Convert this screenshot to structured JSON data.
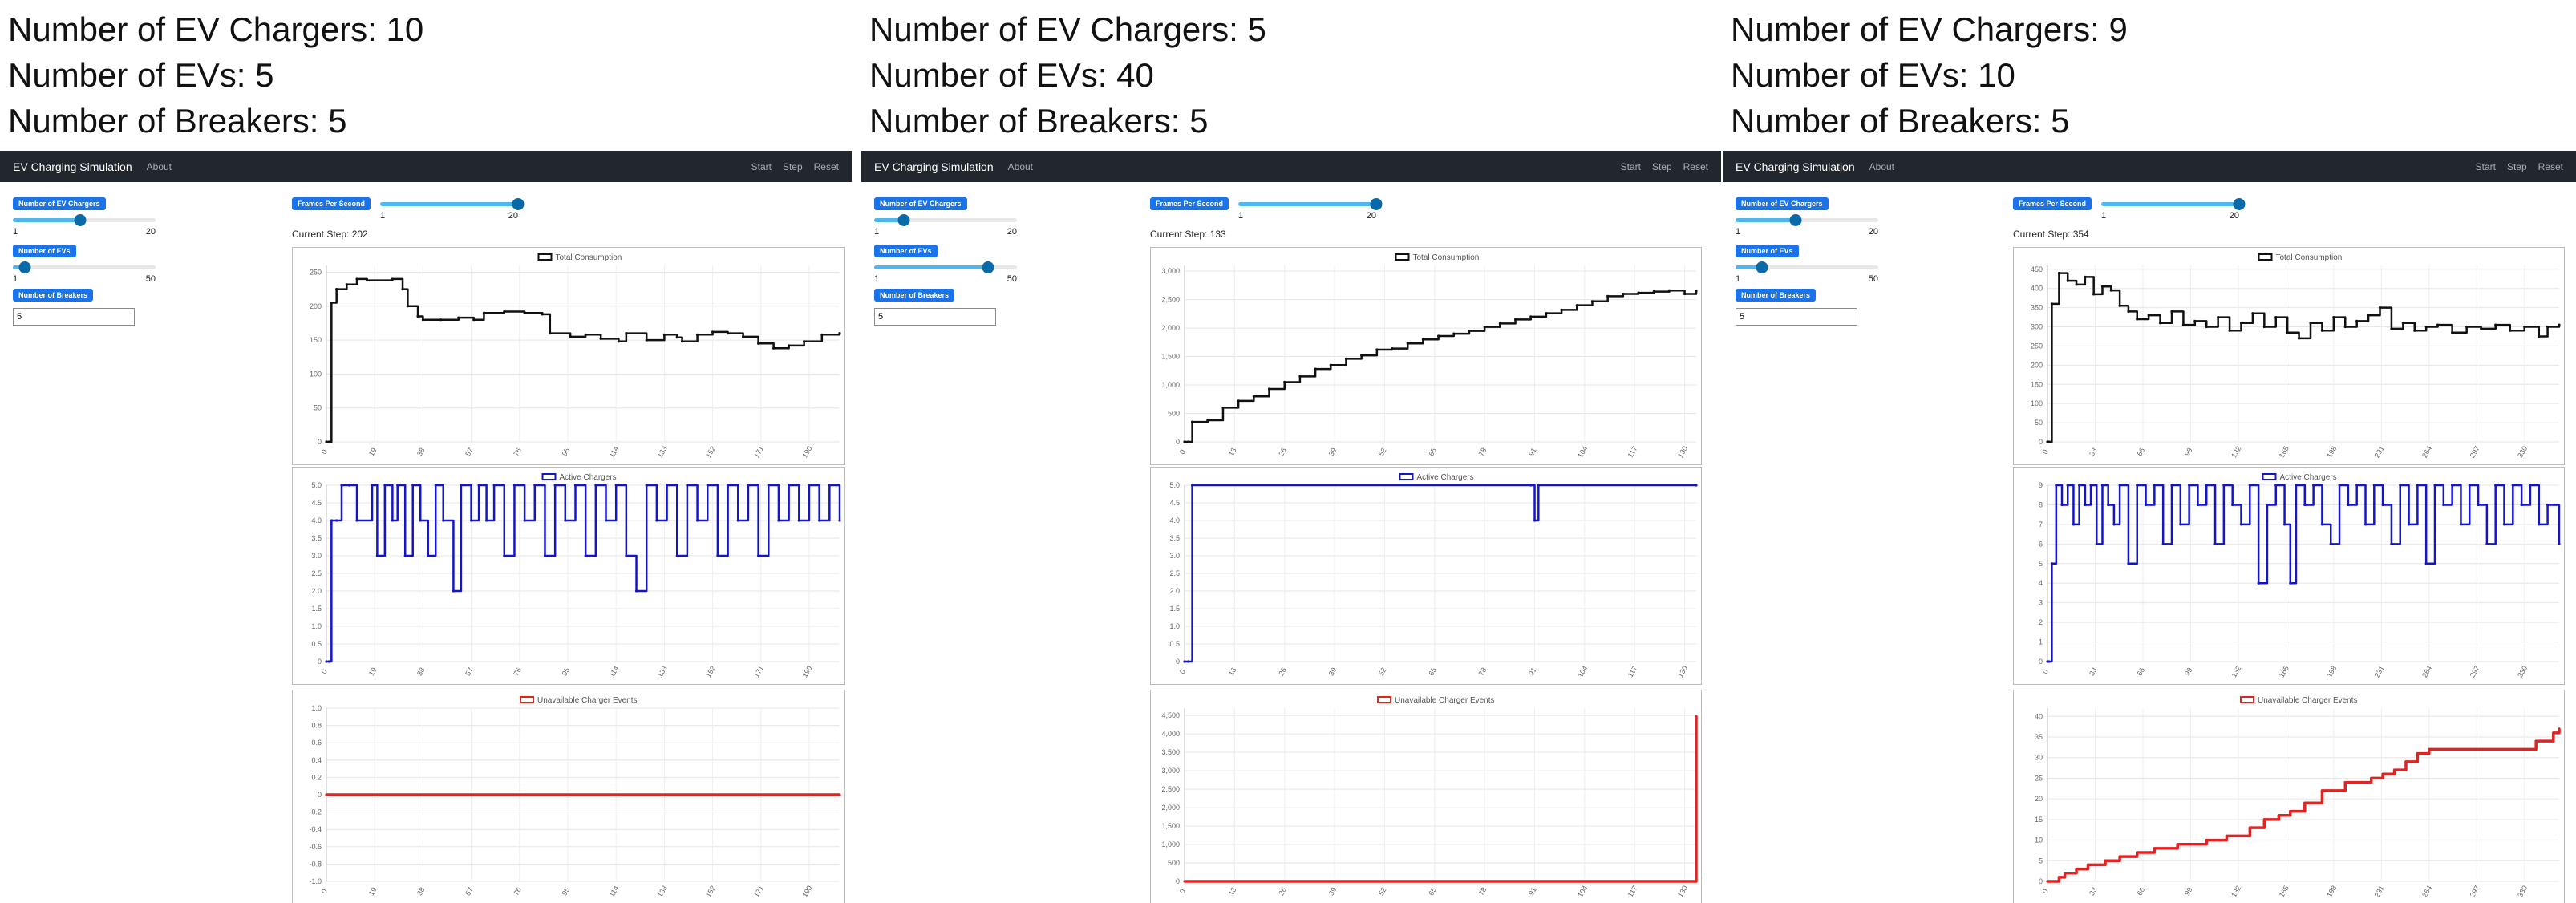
{
  "captions": [
    {
      "chargers": "Number of EV Chargers: 10",
      "evs": "Number of EVs: 5",
      "breakers": "Number of Breakers: 5"
    },
    {
      "chargers": "Number of EV Chargers: 5",
      "evs": "Number of EVs: 40",
      "breakers": "Number of Breakers: 5"
    },
    {
      "chargers": "Number of EV Chargers: 9",
      "evs": "Number of EVs: 10",
      "breakers": "Number of Breakers: 5"
    }
  ],
  "navbar": {
    "brand": "EV Charging Simulation",
    "about": "About",
    "start": "Start",
    "step": "Step",
    "reset": "Reset"
  },
  "controls": {
    "chargers_label": "Number of EV Chargers",
    "evs_label": "Number of EVs",
    "breakers_label": "Number of Breakers",
    "fps_label": "Frames Per Second",
    "current_step_prefix": "Current Step: "
  },
  "panels": [
    {
      "chargers": {
        "value": 10,
        "min": "1",
        "max": "20"
      },
      "evs": {
        "value": 5,
        "min": "1",
        "max": "50"
      },
      "breakers_value": "5",
      "fps": {
        "value": 20,
        "min": "1",
        "max": "20"
      },
      "current_step": "Current Step: 202"
    },
    {
      "chargers": {
        "value": 5,
        "min": "1",
        "max": "20"
      },
      "evs": {
        "value": 40,
        "min": "1",
        "max": "50"
      },
      "breakers_value": "5",
      "fps": {
        "value": 20,
        "min": "1",
        "max": "20"
      },
      "current_step": "Current Step: 133"
    },
    {
      "chargers": {
        "value": 9,
        "min": "1",
        "max": "20"
      },
      "evs": {
        "value": 10,
        "min": "1",
        "max": "50"
      },
      "breakers_value": "5",
      "fps": {
        "value": 20,
        "min": "1",
        "max": "20"
      },
      "current_step": "Current Step: 354"
    }
  ],
  "colors": {
    "consumption": "#111111",
    "active": "#1515c8",
    "unavailable": "#e02424",
    "navbar": "#22272d",
    "badge": "#1a73e8"
  },
  "chart_data": [
    {
      "panel": 1,
      "type": "line",
      "legend": "Total Consumption",
      "x_ticks": [
        "0",
        "19",
        "38",
        "57",
        "76",
        "95",
        "114",
        "133",
        "152",
        "171",
        "190"
      ],
      "y_ticks": [
        "0",
        "50",
        "100",
        "150",
        "200",
        "250"
      ],
      "ylim": [
        0,
        260
      ],
      "xlim": [
        0,
        202
      ],
      "x": [
        0,
        1,
        2,
        4,
        8,
        12,
        16,
        26,
        30,
        32,
        36,
        38,
        45,
        52,
        58,
        62,
        70,
        78,
        85,
        88,
        96,
        102,
        108,
        115,
        118,
        126,
        133,
        138,
        140,
        146,
        152,
        158,
        164,
        170,
        176,
        182,
        188,
        195,
        202
      ],
      "y": [
        0,
        0,
        205,
        225,
        232,
        240,
        238,
        240,
        225,
        200,
        185,
        180,
        180,
        183,
        180,
        190,
        192,
        190,
        188,
        160,
        155,
        158,
        152,
        148,
        160,
        150,
        158,
        154,
        148,
        158,
        162,
        160,
        155,
        145,
        138,
        142,
        148,
        158,
        160
      ]
    },
    {
      "panel": 1,
      "type": "line",
      "legend": "Active Chargers",
      "x_ticks": [
        "0",
        "19",
        "38",
        "57",
        "76",
        "95",
        "114",
        "133",
        "152",
        "171",
        "190"
      ],
      "y_ticks": [
        "0",
        "0.5",
        "1.0",
        "1.5",
        "2.0",
        "2.5",
        "3.0",
        "3.5",
        "4.0",
        "4.5",
        "5.0"
      ],
      "ylim": [
        0,
        5
      ],
      "xlim": [
        0,
        202
      ],
      "x": [
        0,
        1,
        2,
        4,
        6,
        9,
        12,
        18,
        20,
        23,
        26,
        28,
        31,
        34,
        37,
        40,
        43,
        46,
        50,
        53,
        57,
        60,
        63,
        66,
        70,
        74,
        78,
        82,
        86,
        90,
        94,
        98,
        102,
        106,
        110,
        114,
        118,
        122,
        126,
        130,
        134,
        138,
        142,
        146,
        150,
        154,
        158,
        162,
        166,
        170,
        174,
        178,
        182,
        186,
        190,
        194,
        198,
        202
      ],
      "y": [
        0,
        0,
        4,
        4,
        5,
        5,
        4,
        5,
        3,
        5,
        4,
        5,
        3,
        5,
        4,
        3,
        5,
        4,
        2,
        5,
        4,
        5,
        4,
        5,
        3,
        5,
        4,
        5,
        3,
        5,
        4,
        5,
        3,
        5,
        4,
        5,
        3,
        2,
        5,
        4,
        5,
        3,
        5,
        4,
        5,
        3,
        5,
        4,
        5,
        3,
        5,
        4,
        5,
        4,
        5,
        4,
        5,
        4
      ]
    },
    {
      "panel": 1,
      "type": "line",
      "legend": "Unavailable Charger Events",
      "x_ticks": [
        "0",
        "19",
        "38",
        "57",
        "76",
        "95",
        "114",
        "133",
        "152",
        "171",
        "190"
      ],
      "y_ticks": [
        "-1.0",
        "-0.8",
        "-0.6",
        "-0.4",
        "-0.2",
        "0",
        "0.2",
        "0.4",
        "0.6",
        "0.8",
        "1.0"
      ],
      "ylim": [
        -1,
        1
      ],
      "xlim": [
        0,
        202
      ],
      "x": [
        0,
        202
      ],
      "y": [
        0,
        0
      ]
    },
    {
      "panel": 2,
      "type": "line",
      "legend": "Total Consumption",
      "x_ticks": [
        "0",
        "13",
        "26",
        "39",
        "52",
        "65",
        "78",
        "91",
        "104",
        "117",
        "130"
      ],
      "y_ticks": [
        "0",
        "500",
        "1,000",
        "1,500",
        "2,000",
        "2,500",
        "3,000"
      ],
      "ylim": [
        0,
        3100
      ],
      "xlim": [
        0,
        133
      ],
      "x": [
        0,
        1,
        2,
        6,
        10,
        14,
        18,
        22,
        26,
        30,
        34,
        38,
        42,
        46,
        50,
        54,
        58,
        62,
        66,
        70,
        74,
        78,
        82,
        86,
        90,
        94,
        98,
        102,
        106,
        110,
        114,
        118,
        122,
        126,
        130,
        133
      ],
      "y": [
        0,
        0,
        350,
        380,
        600,
        720,
        800,
        930,
        1050,
        1150,
        1280,
        1350,
        1460,
        1520,
        1620,
        1640,
        1730,
        1800,
        1860,
        1900,
        1950,
        2020,
        2080,
        2150,
        2200,
        2260,
        2320,
        2400,
        2470,
        2560,
        2600,
        2620,
        2640,
        2660,
        2600,
        2650
      ]
    },
    {
      "panel": 2,
      "type": "line",
      "legend": "Active Chargers",
      "x_ticks": [
        "0",
        "13",
        "26",
        "39",
        "52",
        "65",
        "78",
        "91",
        "104",
        "117",
        "130"
      ],
      "y_ticks": [
        "0",
        "0.5",
        "1.0",
        "1.5",
        "2.0",
        "2.5",
        "3.0",
        "3.5",
        "4.0",
        "4.5",
        "5.0"
      ],
      "ylim": [
        0,
        5
      ],
      "xlim": [
        0,
        133
      ],
      "x": [
        0,
        1,
        2,
        90,
        91,
        92,
        133
      ],
      "y": [
        0,
        0,
        5,
        5,
        4,
        5,
        5
      ]
    },
    {
      "panel": 2,
      "type": "line",
      "legend": "Unavailable Charger Events",
      "x_ticks": [
        "0",
        "13",
        "26",
        "39",
        "52",
        "65",
        "78",
        "91",
        "104",
        "117",
        "130"
      ],
      "y_ticks": [
        "0",
        "500",
        "1,000",
        "1,500",
        "2,000",
        "2,500",
        "3,000",
        "3,500",
        "4,000",
        "4,500"
      ],
      "ylim": [
        0,
        4700
      ],
      "xlim": [
        0,
        133
      ],
      "x": [
        0,
        133
      ],
      "y": [
        0,
        4480
      ]
    },
    {
      "panel": 3,
      "type": "line",
      "legend": "Total Consumption",
      "x_ticks": [
        "0",
        "33",
        "66",
        "99",
        "132",
        "165",
        "198",
        "231",
        "264",
        "297",
        "330"
      ],
      "y_ticks": [
        "0",
        "50",
        "100",
        "150",
        "200",
        "250",
        "300",
        "350",
        "400",
        "450"
      ],
      "ylim": [
        0,
        460
      ],
      "xlim": [
        0,
        354
      ],
      "x": [
        0,
        1,
        3,
        8,
        14,
        20,
        26,
        32,
        38,
        44,
        50,
        56,
        62,
        70,
        78,
        86,
        94,
        102,
        110,
        118,
        126,
        134,
        142,
        150,
        158,
        166,
        174,
        182,
        190,
        198,
        206,
        214,
        222,
        230,
        238,
        246,
        254,
        262,
        270,
        280,
        290,
        300,
        310,
        320,
        330,
        340,
        346,
        354
      ],
      "y": [
        0,
        0,
        360,
        440,
        420,
        410,
        430,
        385,
        405,
        395,
        355,
        340,
        320,
        330,
        310,
        340,
        305,
        315,
        300,
        325,
        290,
        310,
        335,
        300,
        325,
        285,
        270,
        310,
        290,
        325,
        300,
        315,
        330,
        350,
        295,
        310,
        290,
        300,
        305,
        285,
        300,
        295,
        305,
        290,
        300,
        275,
        300,
        305
      ]
    },
    {
      "panel": 3,
      "type": "line",
      "legend": "Active Chargers",
      "x_ticks": [
        "0",
        "33",
        "66",
        "99",
        "132",
        "165",
        "198",
        "231",
        "264",
        "297",
        "330"
      ],
      "y_ticks": [
        "0",
        "1",
        "2",
        "3",
        "4",
        "5",
        "6",
        "7",
        "8",
        "9"
      ],
      "ylim": [
        0,
        9
      ],
      "xlim": [
        0,
        354
      ],
      "x": [
        0,
        1,
        3,
        6,
        10,
        14,
        18,
        22,
        26,
        30,
        34,
        38,
        42,
        46,
        50,
        56,
        62,
        68,
        74,
        80,
        86,
        92,
        98,
        104,
        110,
        116,
        122,
        128,
        134,
        140,
        146,
        152,
        158,
        164,
        168,
        172,
        178,
        184,
        190,
        196,
        202,
        208,
        214,
        220,
        226,
        232,
        238,
        244,
        250,
        256,
        262,
        268,
        274,
        280,
        286,
        292,
        298,
        304,
        310,
        316,
        322,
        328,
        334,
        340,
        346,
        354
      ],
      "y": [
        0,
        0,
        5,
        9,
        8,
        9,
        7,
        9,
        8,
        9,
        6,
        9,
        8,
        7,
        9,
        5,
        9,
        8,
        9,
        6,
        9,
        7,
        9,
        8,
        9,
        6,
        9,
        8,
        7,
        9,
        4,
        8,
        9,
        7,
        4,
        9,
        8,
        9,
        7,
        6,
        9,
        8,
        9,
        7,
        9,
        8,
        6,
        9,
        7,
        9,
        5,
        9,
        8,
        9,
        7,
        9,
        8,
        6,
        9,
        7,
        9,
        8,
        9,
        7,
        8,
        6
      ]
    },
    {
      "panel": 3,
      "type": "line",
      "legend": "Unavailable Charger Events",
      "x_ticks": [
        "0",
        "33",
        "66",
        "99",
        "132",
        "165",
        "198",
        "231",
        "264",
        "297",
        "330"
      ],
      "y_ticks": [
        "0",
        "5",
        "10",
        "15",
        "20",
        "25",
        "30",
        "35",
        "40"
      ],
      "ylim": [
        0,
        42
      ],
      "xlim": [
        0,
        354
      ],
      "x": [
        0,
        2,
        8,
        12,
        20,
        28,
        40,
        50,
        62,
        74,
        90,
        110,
        124,
        140,
        150,
        160,
        168,
        178,
        190,
        206,
        214,
        224,
        232,
        240,
        248,
        256,
        264,
        272,
        300,
        320,
        338,
        344,
        350,
        354
      ],
      "y": [
        0,
        0,
        1,
        2,
        3,
        4,
        5,
        6,
        7,
        8,
        9,
        10,
        11,
        13,
        15,
        16,
        17,
        19,
        22,
        24,
        24,
        25,
        26,
        27,
        29,
        31,
        32,
        32,
        32,
        32,
        34,
        34,
        36,
        37
      ]
    }
  ]
}
